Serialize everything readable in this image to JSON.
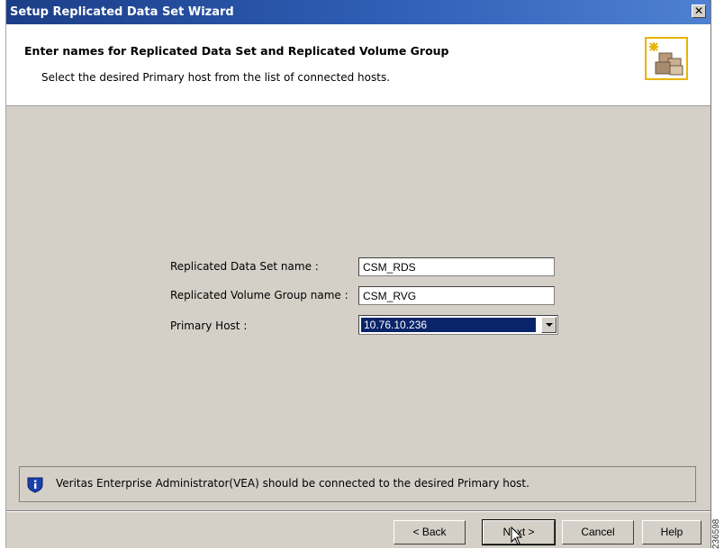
{
  "window": {
    "title": "Setup Replicated Data Set Wizard",
    "close_label": "✕"
  },
  "header": {
    "heading": "Enter names for Replicated Data Set and Replicated Volume Group",
    "subheading": "Select the desired Primary host from the list of connected hosts.",
    "icon": "wizard-package-icon"
  },
  "form": {
    "rds_label": "Replicated Data Set name :",
    "rds_value": "CSM_RDS",
    "rvg_label": "Replicated Volume Group name :",
    "rvg_value": "CSM_RVG",
    "host_label": "Primary Host :",
    "host_value": "10.76.10.236"
  },
  "info": {
    "icon": "info-icon",
    "text": "Veritas Enterprise Administrator(VEA) should be connected to the desired Primary host."
  },
  "buttons": {
    "back": "< Back",
    "next": "Next >",
    "cancel": "Cancel",
    "help": "Help"
  },
  "side_code": "236598",
  "colors": {
    "titlebar": "#2f5fb7",
    "selection": "#0a246a",
    "icon_border": "#e8b400"
  }
}
